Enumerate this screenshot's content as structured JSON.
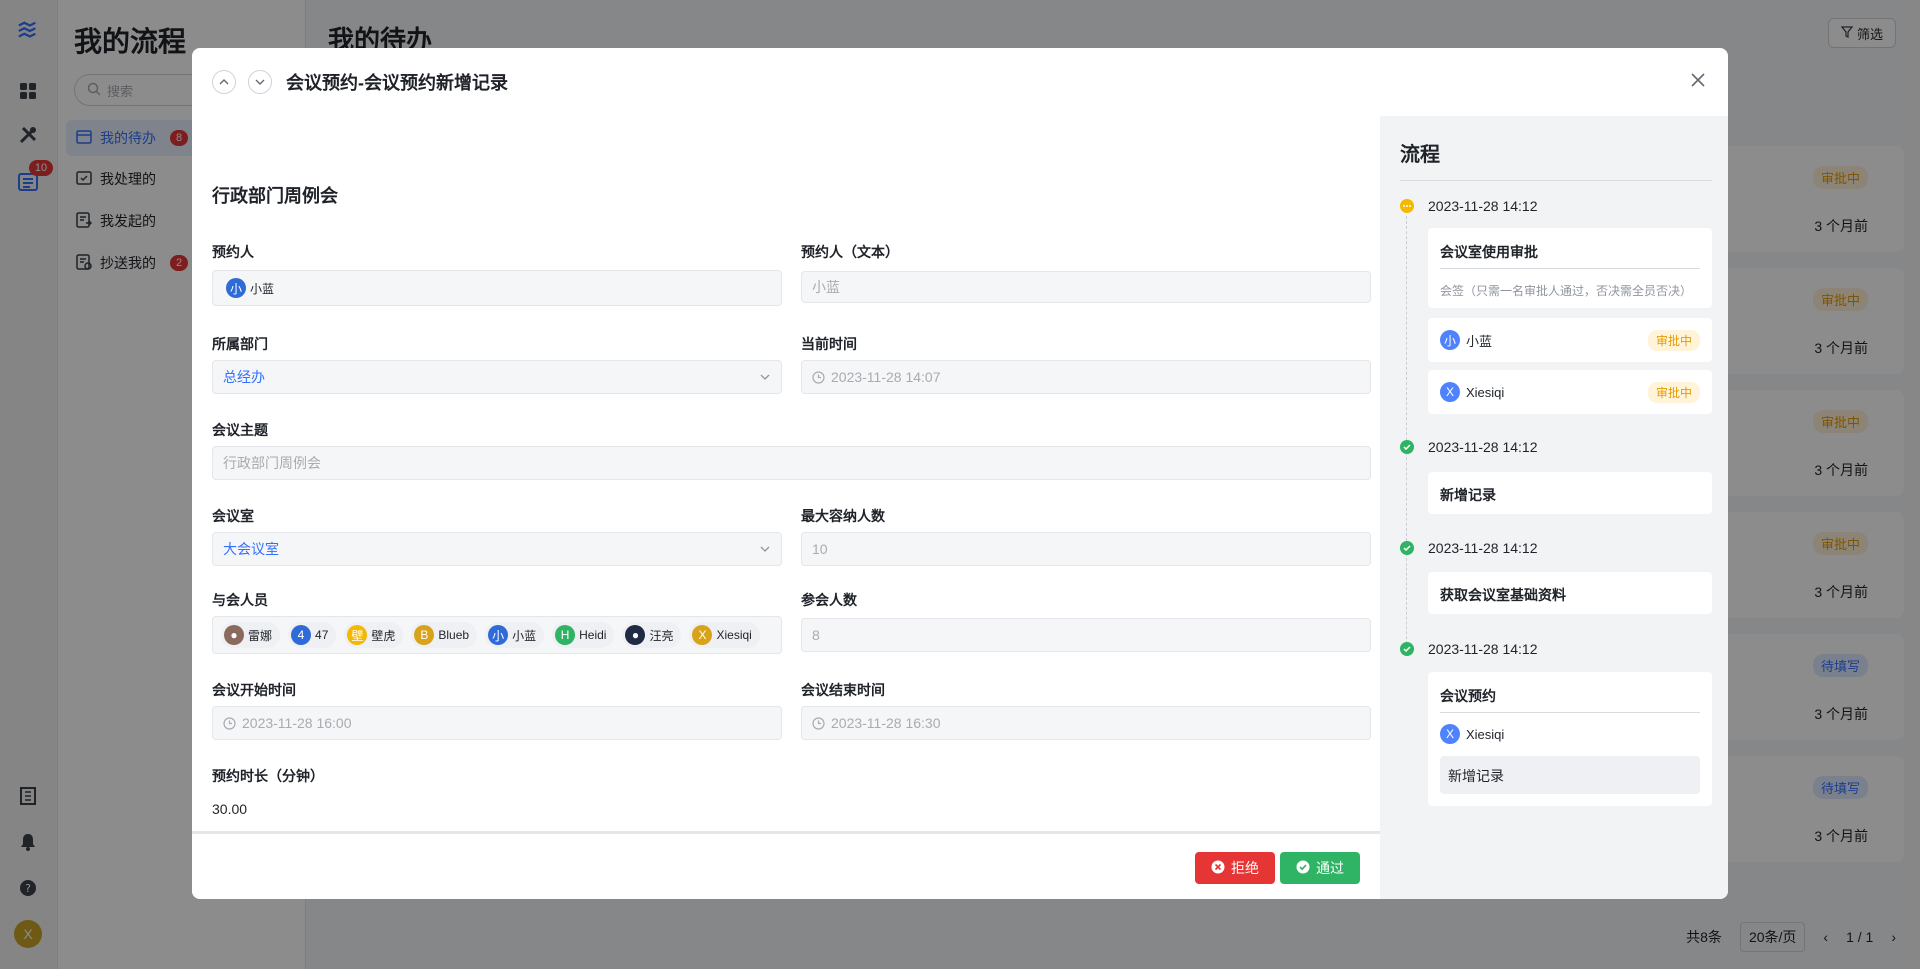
{
  "rail": {
    "badge_count": "10",
    "avatar_letter": "X",
    "icons": [
      "logo-icon",
      "grid-icon",
      "tools-icon",
      "list-icon",
      "building-icon",
      "bell-icon",
      "help-icon"
    ]
  },
  "subnav": {
    "title": "我的流程",
    "search_placeholder": "搜索",
    "items": [
      {
        "label": "我的待办",
        "badge": "8",
        "active": true
      },
      {
        "label": "我处理的",
        "badge": "",
        "active": false
      },
      {
        "label": "我发起的",
        "badge": "",
        "active": false
      },
      {
        "label": "抄送我的",
        "badge": "2",
        "active": false
      }
    ]
  },
  "main": {
    "title": "我的待办",
    "filter_label": "筛选",
    "rows": [
      {
        "status": "审批中",
        "time": "3 个月前"
      },
      {
        "status": "审批中",
        "time": "3 个月前"
      },
      {
        "status": "审批中",
        "time": "3 个月前"
      },
      {
        "status": "审批中",
        "time": "3 个月前"
      },
      {
        "status": "待填写",
        "time": "3 个月前"
      },
      {
        "status": "待填写",
        "time": "3 个月前"
      }
    ],
    "pager": {
      "total": "共8条",
      "size": "20条/页",
      "page": "1 / 1"
    }
  },
  "modal": {
    "title": "会议预约-会议预约新增记录",
    "form_heading": "行政部门周例会",
    "fields": {
      "booker_label": "预约人",
      "booker_value": "小蓝",
      "booker_text_label": "预约人（文本）",
      "booker_text_value": "小蓝",
      "dept_label": "所属部门",
      "dept_value": "总经办",
      "now_label": "当前时间",
      "now_value": "2023-11-28 14:07",
      "topic_label": "会议主题",
      "topic_value": "行政部门周例会",
      "room_label": "会议室",
      "room_value": "大会议室",
      "capacity_label": "最大容纳人数",
      "capacity_value": "10",
      "attendees_label": "与会人员",
      "attendees": [
        {
          "initial": "",
          "name": "雷娜",
          "color": "#8a6a5c"
        },
        {
          "initial": "4",
          "name": "47",
          "color": "#2f6bd8"
        },
        {
          "initial": "壁",
          "name": "壁虎",
          "color": "#f5b800"
        },
        {
          "initial": "B",
          "name": "Blueb",
          "color": "#d9a21b"
        },
        {
          "initial": "小",
          "name": "小蓝",
          "color": "#2f6bd8"
        },
        {
          "initial": "H",
          "name": "Heidi",
          "color": "#2fb364"
        },
        {
          "initial": "",
          "name": "汪亮",
          "color": "#1f2a44"
        },
        {
          "initial": "X",
          "name": "Xiesiqi",
          "color": "#d9a21b"
        }
      ],
      "attendee_count_label": "参会人数",
      "attendee_count_value": "8",
      "start_label": "会议开始时间",
      "start_value": "2023-11-28 16:00",
      "end_label": "会议结束时间",
      "end_value": "2023-11-28 16:30",
      "duration_label": "预约时长（分钟）",
      "duration_value": "30.00"
    },
    "reject_label": "拒绝",
    "pass_label": "通过"
  },
  "flow": {
    "title": "流程",
    "nodes": [
      {
        "time": "2023-11-28 14:12",
        "state": "wait",
        "title": "会议室使用审批",
        "note": "会签（只需一名审批人通过，否决需全员否决）",
        "approvers": [
          {
            "initial": "小",
            "name": "小蓝",
            "status": "审批中"
          },
          {
            "initial": "X",
            "name": "Xiesiqi",
            "status": "审批中"
          }
        ]
      },
      {
        "time": "2023-11-28 14:12",
        "state": "ok",
        "title": "新增记录"
      },
      {
        "time": "2023-11-28 14:12",
        "state": "ok",
        "title": "获取会议室基础资料"
      },
      {
        "time": "2023-11-28 14:12",
        "state": "ok",
        "title": "会议预约",
        "user": {
          "initial": "X",
          "name": "Xiesiqi"
        },
        "sub": "新增记录"
      }
    ]
  },
  "colors": {
    "primary": "#3370ff",
    "danger": "#e63535",
    "success": "#2fb364",
    "warning": "#f5b800"
  }
}
